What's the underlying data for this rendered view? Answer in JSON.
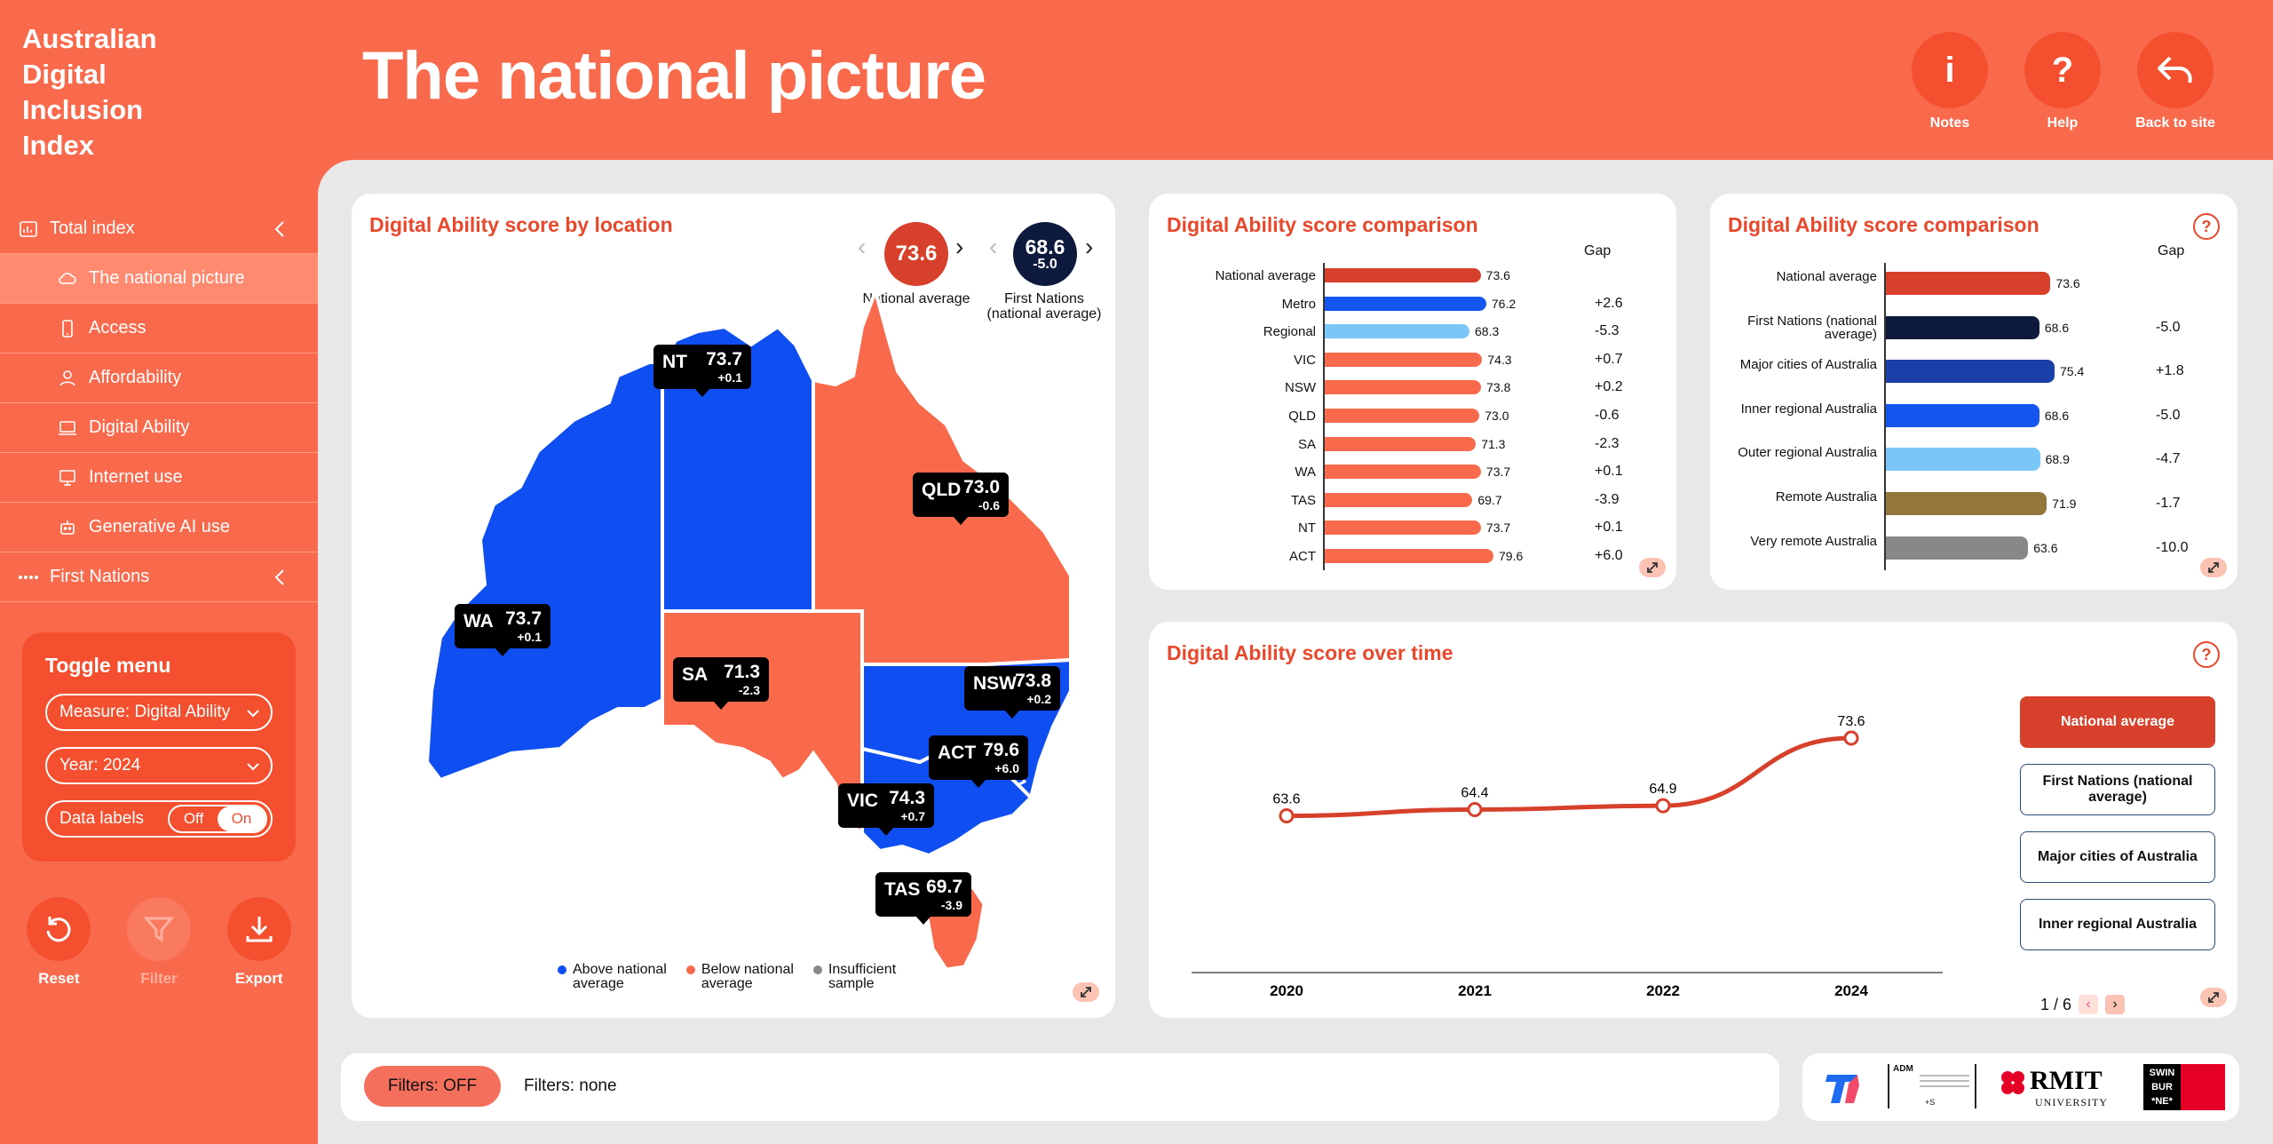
{
  "brand": {
    "lines": [
      "Australian",
      "Digital",
      "Inclusion",
      "Index"
    ]
  },
  "nav": {
    "total_index": "Total index",
    "items": [
      {
        "label": "The national picture",
        "icon": "cloud-icon"
      },
      {
        "label": "Access",
        "icon": "phone-icon"
      },
      {
        "label": "Affordability",
        "icon": "wallet-icon"
      },
      {
        "label": "Digital Ability",
        "icon": "laptop-person-icon"
      },
      {
        "label": "Internet use",
        "icon": "computer-icon"
      },
      {
        "label": "Generative AI use",
        "icon": "robot-icon"
      }
    ],
    "first_nations": "First Nations"
  },
  "toggle_menu": {
    "title": "Toggle menu",
    "measure": "Measure: Digital Ability",
    "year": "Year: 2024",
    "data_labels": "Data labels",
    "off": "Off",
    "on": "On"
  },
  "actions": {
    "reset": "Reset",
    "filter": "Filter",
    "export": "Export"
  },
  "header": {
    "title": "The national picture",
    "notes": "Notes",
    "help": "Help",
    "back": "Back to site"
  },
  "colors": {
    "above": "#0f4ef0",
    "below": "#f96a4c",
    "insufficient": "#888888",
    "accent": "#e8482b"
  },
  "map_card": {
    "title": "Digital Ability score by location",
    "national": {
      "value": "73.6",
      "caption": "National average"
    },
    "first_nations": {
      "value": "68.6",
      "gap": "-5.0",
      "caption_1": "First Nations",
      "caption_2": "(national average)"
    },
    "states": [
      {
        "name": "NT",
        "value": "73.7",
        "gap": "+0.1"
      },
      {
        "name": "QLD",
        "value": "73.0",
        "gap": "-0.6"
      },
      {
        "name": "WA",
        "value": "73.7",
        "gap": "+0.1"
      },
      {
        "name": "SA",
        "value": "71.3",
        "gap": "-2.3"
      },
      {
        "name": "NSW",
        "value": "73.8",
        "gap": "+0.2"
      },
      {
        "name": "ACT",
        "value": "79.6",
        "gap": "+6.0"
      },
      {
        "name": "VIC",
        "value": "74.3",
        "gap": "+0.7"
      },
      {
        "name": "TAS",
        "value": "69.7",
        "gap": "-3.9"
      }
    ],
    "legend": [
      {
        "l1": "Above national",
        "l2": "average"
      },
      {
        "l1": "Below national",
        "l2": "average"
      },
      {
        "l1": "Insufficient",
        "l2": "sample"
      }
    ]
  },
  "chart_data": [
    {
      "type": "bar",
      "title": "Digital Ability score comparison",
      "gap_header": "Gap",
      "categories": [
        "National average",
        "Metro",
        "Regional",
        "VIC",
        "NSW",
        "QLD",
        "SA",
        "WA",
        "TAS",
        "NT",
        "ACT"
      ],
      "values": [
        73.6,
        76.2,
        68.3,
        74.3,
        73.8,
        73.0,
        71.3,
        73.7,
        69.7,
        73.7,
        79.6
      ],
      "labels": [
        "73.6",
        "76.2",
        "68.3",
        "74.3",
        "73.8",
        "73.0",
        "71.3",
        "73.7",
        "69.7",
        "73.7",
        "79.6"
      ],
      "gaps": [
        "",
        "+2.6",
        "-5.3",
        "+0.7",
        "+0.2",
        "-0.6",
        "-2.3",
        "+0.1",
        "-3.9",
        "+0.1",
        "+6.0"
      ],
      "colors": [
        "#d7402a",
        "#1656f0",
        "#7ac6f7",
        "#f96a4c",
        "#f96a4c",
        "#f96a4c",
        "#f96a4c",
        "#f96a4c",
        "#f96a4c",
        "#f96a4c",
        "#f96a4c"
      ]
    },
    {
      "type": "bar",
      "title": "Digital Ability score comparison",
      "gap_header": "Gap",
      "categories": [
        "National average",
        "First Nations (national average)",
        "Major cities of Australia",
        "Inner regional Australia",
        "Outer regional Australia",
        "Remote Australia",
        "Very remote Australia"
      ],
      "values": [
        73.6,
        68.6,
        75.4,
        68.6,
        68.9,
        71.9,
        63.6
      ],
      "labels": [
        "73.6",
        "68.6",
        "75.4",
        "68.6",
        "68.9",
        "71.9",
        "63.6"
      ],
      "gaps": [
        "",
        "-5.0",
        "+1.8",
        "-5.0",
        "-4.7",
        "-1.7",
        "-10.0"
      ],
      "colors": [
        "#d7402a",
        "#0d1a3d",
        "#1b3fa8",
        "#1656f0",
        "#7ac6f7",
        "#94753c",
        "#888888"
      ]
    },
    {
      "type": "line",
      "title": "Digital Ability score over time",
      "x": [
        "2020",
        "2021",
        "2022",
        "2024"
      ],
      "series": [
        {
          "name": "National average",
          "values": [
            63.6,
            64.4,
            64.9,
            73.6
          ]
        }
      ],
      "labels": [
        "63.6",
        "64.4",
        "64.9",
        "73.6"
      ],
      "color": "#d7402a"
    }
  ],
  "line_card": {
    "buttons": [
      "National average",
      "First Nations (national average)",
      "Major cities of Australia",
      "Inner regional Australia"
    ],
    "pager": "1 / 6"
  },
  "footer": {
    "filters_pill": "Filters: OFF",
    "filters_text": "Filters: none"
  },
  "logos": {
    "adm": "ADM",
    "adm_plus": "+S",
    "rmit": "RMIT",
    "rmit_sub": "UNIVERSITY",
    "swin": [
      "SWIN",
      "BUR",
      "*NE*"
    ]
  }
}
